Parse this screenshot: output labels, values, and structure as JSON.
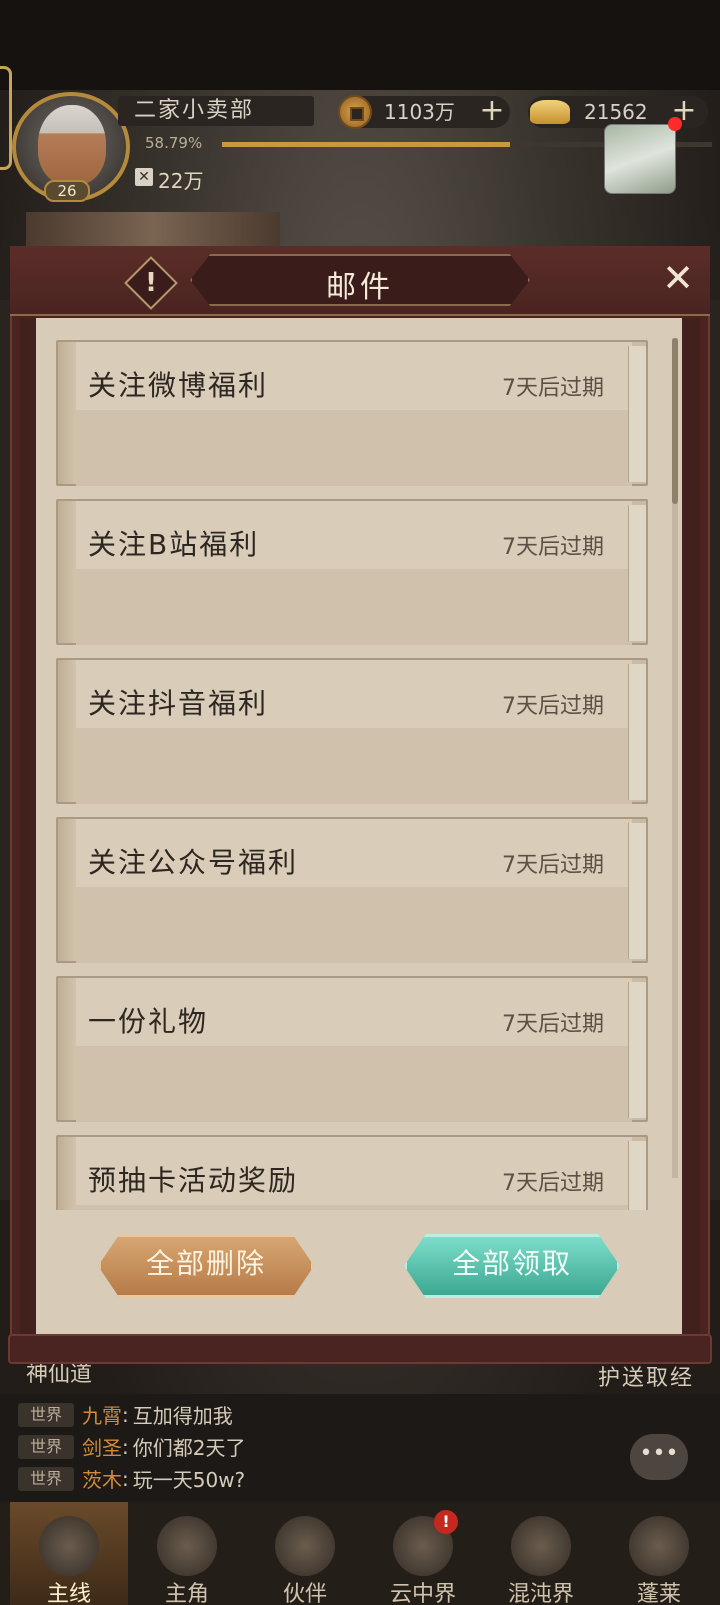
{
  "header": {
    "player_name": "二家小卖部",
    "level": "26",
    "xp_percent": "58.79%",
    "xp_fraction": 0.5879,
    "power": "22万",
    "coins": "1103万",
    "ingots": "21562"
  },
  "mail_dialog": {
    "title": "邮件",
    "help_mark": "!",
    "close_symbol": "✕",
    "mails": [
      {
        "title": "关注微博福利",
        "expiry": "7天后过期"
      },
      {
        "title": "关注B站福利",
        "expiry": "7天后过期"
      },
      {
        "title": "关注抖音福利",
        "expiry": "7天后过期"
      },
      {
        "title": "关注公众号福利",
        "expiry": "7天后过期"
      },
      {
        "title": "一份礼物",
        "expiry": "7天后过期"
      },
      {
        "title": "预抽卡活动奖励",
        "expiry": "7天后过期"
      }
    ],
    "delete_all_label": "全部删除",
    "claim_all_label": "全部领取"
  },
  "scene": {
    "left_label": "神仙道",
    "right_label": "护送取经"
  },
  "chat": {
    "messages": [
      {
        "channel": "世界",
        "name": "九霄",
        "separator": ":",
        "text": "互加得加我"
      },
      {
        "channel": "世界",
        "name": "剑圣",
        "separator": ":",
        "text": "你们都2天了"
      },
      {
        "channel": "世界",
        "name": "茨木",
        "separator": ":",
        "text": "玩一天50w?"
      }
    ],
    "bubble_symbol": "•••"
  },
  "bottom_nav": {
    "items": [
      {
        "label": "主线",
        "active": true
      },
      {
        "label": "主角",
        "active": false
      },
      {
        "label": "伙伴",
        "active": false
      },
      {
        "label": "云中界",
        "active": false
      },
      {
        "label": "混沌界",
        "active": false
      },
      {
        "label": "蓬莱",
        "active": false
      }
    ],
    "alert_mark": "!"
  },
  "colors": {
    "dialog_frame": "#4a2421",
    "parchment": "#d8ccb8",
    "delete_button": "#c48d5b",
    "claim_button": "#5cc2ad",
    "chat_name": "#d18b3a",
    "alert_red": "#c4281f"
  }
}
